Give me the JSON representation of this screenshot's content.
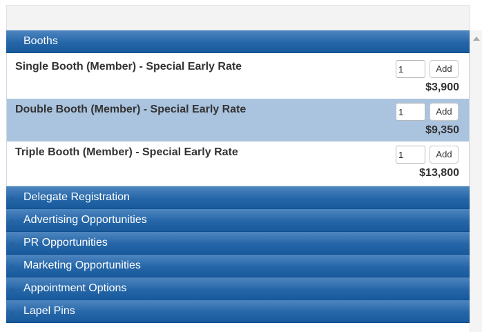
{
  "sections": [
    {
      "label": "Booths",
      "expanded": true
    },
    {
      "label": "Delegate Registration",
      "expanded": false
    },
    {
      "label": "Advertising Opportunities",
      "expanded": false
    },
    {
      "label": "PR Opportunities",
      "expanded": false
    },
    {
      "label": "Marketing Opportunities",
      "expanded": false
    },
    {
      "label": "Appointment Options",
      "expanded": false
    },
    {
      "label": "Lapel Pins",
      "expanded": false
    }
  ],
  "booths": {
    "add_label": "Add",
    "items": [
      {
        "name": "Single Booth (Member) - Special Early Rate",
        "qty": "1",
        "price": "$3,900"
      },
      {
        "name": "Double Booth (Member) - Special Early Rate",
        "qty": "1",
        "price": "$9,350"
      },
      {
        "name": "Triple Booth (Member) - Special Early Rate",
        "qty": "1",
        "price": "$13,800"
      }
    ]
  },
  "colors": {
    "header_blue": "#2566a8",
    "highlight_row": "#aac3df"
  }
}
